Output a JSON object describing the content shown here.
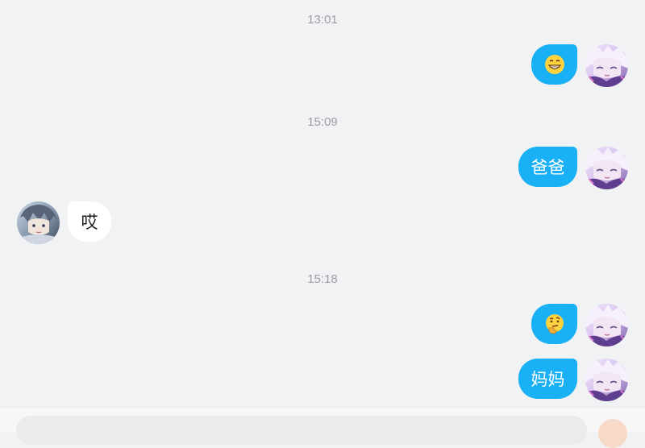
{
  "colors": {
    "background": "#f1f2f4",
    "my_bubble": "#1ab0f5",
    "other_bubble": "#ffffff",
    "timestamp_text": "#9b9ea4"
  },
  "messages": [
    {
      "time": "13:01"
    },
    {
      "sender": "me",
      "emoji": "grinning-face-icon"
    },
    {
      "time": "15:09"
    },
    {
      "sender": "me",
      "text": "爸爸"
    },
    {
      "sender": "other",
      "text": "哎"
    },
    {
      "time": "15:18"
    },
    {
      "sender": "me",
      "emoji": "thinking-face-icon"
    },
    {
      "sender": "me",
      "text": "妈妈"
    }
  ],
  "labels": {
    "time_1": "13:01",
    "time_2": "15:09",
    "time_3": "15:18",
    "msg_baba": "爸爸",
    "msg_ai": "哎",
    "msg_mama": "妈妈"
  },
  "icons": {
    "my_avatar": "anime-girl-avatar",
    "other_avatar": "anime-boy-avatar",
    "emoji_1": "grinning-face-icon",
    "emoji_2": "thinking-face-icon"
  }
}
